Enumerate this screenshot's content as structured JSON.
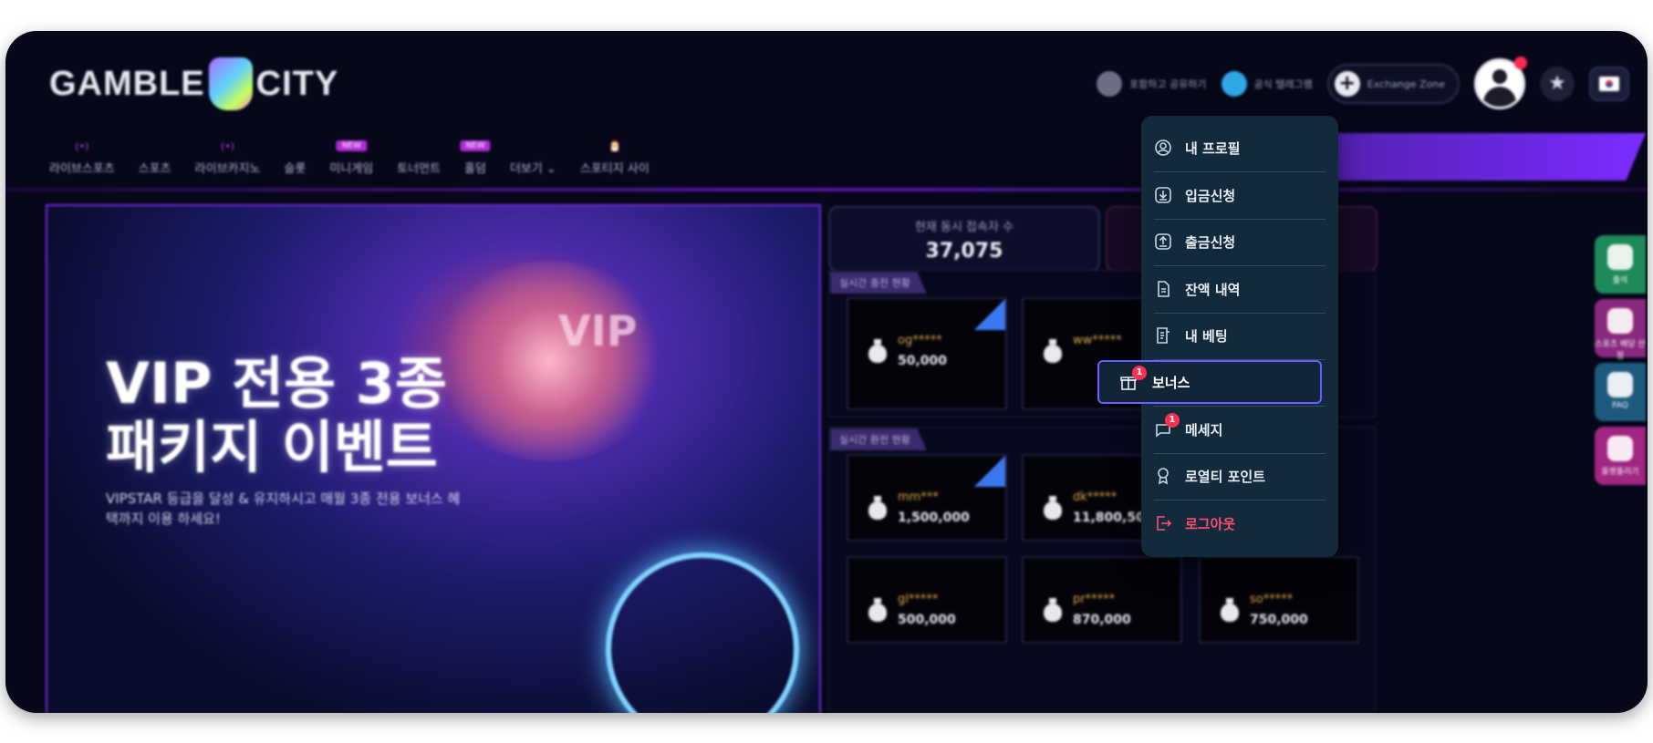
{
  "header": {
    "logo_left": "GAMBLE",
    "logo_right": "CITY",
    "links": [
      {
        "label": "포함하고 공유하기",
        "icon": "globe-icon"
      },
      {
        "label": "공식 텔레그램",
        "icon": "telegram-icon"
      }
    ],
    "exchange_label": "Exchange Zone",
    "notification_dot": true
  },
  "nav": {
    "items": [
      {
        "label": "라이브스포츠",
        "tag": "(•)"
      },
      {
        "label": "스포츠",
        "tag": ""
      },
      {
        "label": "라이브카지노",
        "tag": "(•)"
      },
      {
        "label": "슬롯",
        "tag": ""
      },
      {
        "label": "미니게임",
        "tag": "NEW"
      },
      {
        "label": "토너먼트",
        "tag": ""
      },
      {
        "label": "홀덤",
        "tag": "NEW"
      },
      {
        "label": "더보기",
        "tag": ""
      },
      {
        "label": "스포티지 사이",
        "tag": "🎅"
      }
    ]
  },
  "banner": {
    "title": "VIP 전용 3종\n패키지 이벤트",
    "subtitle": "VIPSTAR 등급을 달성 & 유지하시고 매월 3종 전용 보너스 혜택까지 이용 하세요!",
    "art_word": "VIP"
  },
  "stats": {
    "concurrent_label": "현재 동시 접속자 수",
    "concurrent_value": "37,075"
  },
  "sections": {
    "realtime_deposit": "실시간 충전 현황",
    "realtime_withdraw": "실시간 환전 현황"
  },
  "deposits": [
    {
      "name": "og*****",
      "amount": "50,000"
    },
    {
      "name": "ww*****",
      "amount": ""
    }
  ],
  "withdrawals": [
    {
      "name": "mm***",
      "amount": "1,500,000"
    },
    {
      "name": "dk*****",
      "amount": "11,800,50"
    },
    {
      "name": "gl*****",
      "amount": "500,000"
    },
    {
      "name": "pr*****",
      "amount": "870,000"
    },
    {
      "name": "so*****",
      "amount": "750,000"
    }
  ],
  "side_buttons": [
    {
      "label": "출석",
      "color": "#1e8a5a"
    },
    {
      "label": "스포츠 배당 산정",
      "color": "#8a2a7e"
    },
    {
      "label": "FAQ",
      "color": "#1e5a7e"
    },
    {
      "label": "룰렛돌리기",
      "color": "#a02680"
    }
  ],
  "menu": {
    "items": [
      {
        "label": "내 프로필",
        "icon": "profile-icon"
      },
      {
        "label": "입금신청",
        "icon": "deposit-icon"
      },
      {
        "label": "출금신청",
        "icon": "withdraw-icon"
      },
      {
        "label": "잔액 내역",
        "icon": "balance-history-icon"
      },
      {
        "label": "내 베팅",
        "icon": "betting-icon"
      },
      {
        "label": "보너스",
        "icon": "bonus-icon",
        "badge": "1"
      },
      {
        "label": "메세지",
        "icon": "message-icon",
        "badge": "1"
      },
      {
        "label": "로열티 포인트",
        "icon": "loyalty-icon"
      },
      {
        "label": "로그아웃",
        "icon": "logout-icon"
      }
    ]
  },
  "colors": {
    "background": "#07071a",
    "accent": "#7b2cff",
    "menu_bg": "#132a3d",
    "highlight_border": "#6d5cff",
    "logout": "#ff4f6e"
  }
}
